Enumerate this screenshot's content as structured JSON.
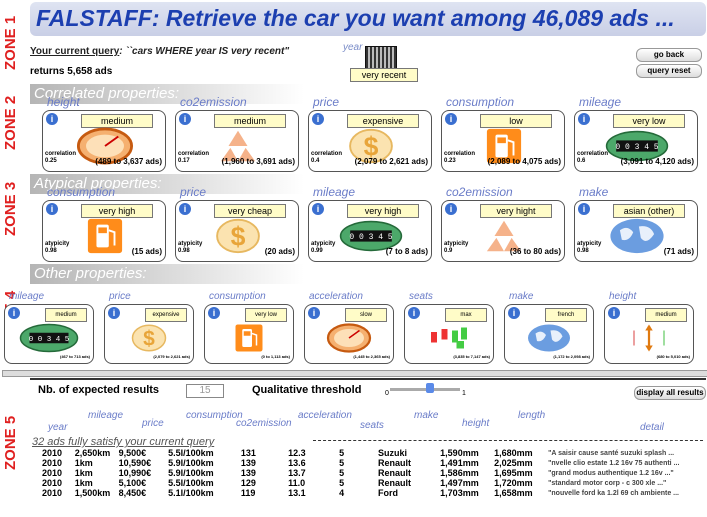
{
  "zones": [
    "ZONE 1",
    "ZONE 2",
    "ZONE 3",
    "ZONE 4",
    "ZONE 5"
  ],
  "title": "FALSTAFF: Retrieve the car you want among 46,089 ads ...",
  "query": {
    "label": "Your current query",
    "text": ": ``cars WHERE year IS very recent\"",
    "returns": "returns 5,658 ads",
    "year_label": "year",
    "year_value": "very recent",
    "go_back": "go back",
    "reset": "query reset"
  },
  "sections": {
    "correlated": "Correlated properties:",
    "atypical": "Atypical properties:",
    "other": "Other properties:"
  },
  "correlated": [
    {
      "prop": "height",
      "value": "medium",
      "stat_label": "correlation",
      "stat": "0.25",
      "count": "(489 to 3,637 ads)",
      "icon": "gauge-icon"
    },
    {
      "prop": "co2emission",
      "value": "medium",
      "stat_label": "correlation",
      "stat": "0.17",
      "count": "(1,960 to 3,691 ads)",
      "icon": "recycle-icon"
    },
    {
      "prop": "price",
      "value": "expensive",
      "stat_label": "correlation",
      "stat": "0.4",
      "count": "(2,079 to 2,621 ads)",
      "icon": "dollar-icon"
    },
    {
      "prop": "consumption",
      "value": "low",
      "stat_label": "correlation",
      "stat": "0.23",
      "count": "(2,089 to 4,075 ads)",
      "icon": "fuel-pump-icon"
    },
    {
      "prop": "mileage",
      "value": "very low",
      "stat_label": "correlation",
      "stat": "0.6",
      "count": "(3,091 to 4,120 ads)",
      "icon": "odometer-icon",
      "odo": "00345"
    }
  ],
  "atypical": [
    {
      "prop": "consumption",
      "value": "very high",
      "stat_label": "atypicity",
      "stat": "0.98",
      "count": "(15 ads)",
      "icon": "fuel-pump-icon"
    },
    {
      "prop": "price",
      "value": "very cheap",
      "stat_label": "atypicity",
      "stat": "0.98",
      "count": "(20 ads)",
      "icon": "dollar-icon"
    },
    {
      "prop": "mileage",
      "value": "very high",
      "stat_label": "atypicity",
      "stat": "0.99",
      "count": "(7 to 8 ads)",
      "icon": "odometer-icon",
      "odo": "00345"
    },
    {
      "prop": "co2emission",
      "value": "very hight",
      "stat_label": "atypicity",
      "stat": "0.9",
      "count": "(36 to 80 ads)",
      "icon": "recycle-icon"
    },
    {
      "prop": "make",
      "value": "asian (other)",
      "stat_label": "atypicity",
      "stat": "0.98",
      "count": "(71 ads)",
      "icon": "globe-icon"
    }
  ],
  "other": [
    {
      "prop": "mileage",
      "value": "medium",
      "count": "(467 to 713 ads)",
      "icon": "odometer-icon"
    },
    {
      "prop": "price",
      "value": "expensive",
      "count": "(2,079 to 2,621 ads)",
      "icon": "dollar-icon"
    },
    {
      "prop": "consumption",
      "value": "very low",
      "count": "(0 to 1,113 ads)",
      "icon": "fuel-pump-icon"
    },
    {
      "prop": "acceleration",
      "value": "slow",
      "count": "(1,445 to 2,365 ads)",
      "icon": "gauge-icon"
    },
    {
      "prop": "seats",
      "value": "max",
      "count": "(3,835 to 7,147 ads)",
      "icon": "seats-icon"
    },
    {
      "prop": "make",
      "value": "french",
      "count": "(1,172 to 2,098 ads)",
      "icon": "globe-icon"
    },
    {
      "prop": "height",
      "value": "medium",
      "count": "(680 to 5,010 ads)",
      "icon": "height-icon"
    }
  ],
  "results": {
    "expected_label": "Nb. of expected results",
    "expected_value": "15",
    "threshold_label": "Qualitative threshold",
    "threshold_min": "0",
    "threshold_max": "1",
    "display_all": "display all results",
    "columns": [
      "year",
      "mileage",
      "price",
      "consumption",
      "co2emission",
      "acceleration",
      "seats",
      "make",
      "height",
      "length",
      "detail"
    ],
    "satisfy": "32 ads fully satisfy your current query",
    "rows": [
      [
        "2010",
        "2,650km",
        "9,500€",
        "5.5l/100km",
        "131",
        "12.3",
        "5",
        "Suzuki",
        "1,590mm",
        "1,680mm",
        "\"A saisir cause santé suzuki splash ..."
      ],
      [
        "2010",
        "1km",
        "10,590€",
        "5.9l/100km",
        "139",
        "13.6",
        "5",
        "Renault",
        "1,491mm",
        "2,025mm",
        "\"nvelle clio estate 1.2 16v 75 authenti ..."
      ],
      [
        "2010",
        "1km",
        "10,990€",
        "5.9l/100km",
        "139",
        "13.7",
        "5",
        "Renault",
        "1,586mm",
        "1,695mm",
        "\"grand modus authentique 1.2 16v ...\""
      ],
      [
        "2010",
        "1km",
        "5,100€",
        "5.5l/100km",
        "129",
        "11.0",
        "5",
        "Renault",
        "1,497mm",
        "1,720mm",
        "\"standard motor corp - c 300 xle ...\""
      ],
      [
        "2010",
        "1,500km",
        "8,450€",
        "5.1l/100km",
        "119",
        "13.1",
        "4",
        "Ford",
        "1,703mm",
        "1,658mm",
        "\"nouvelle ford ka 1.2l 69 ch ambiente ..."
      ]
    ]
  }
}
